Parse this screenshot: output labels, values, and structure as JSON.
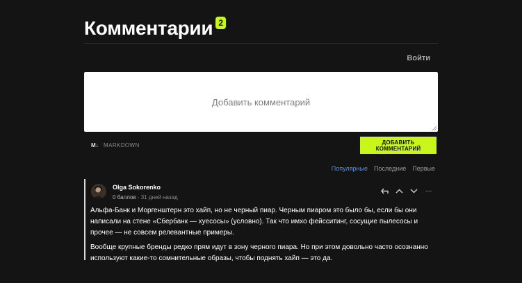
{
  "header": {
    "title": "Комментарии",
    "count": "2"
  },
  "auth": {
    "login_label": "Войти"
  },
  "editor": {
    "placeholder": "Добавить комментарий",
    "markdown_icon": "M↓",
    "markdown_label": "MARKDOWN",
    "submit_label": "ДОБАВИТЬ КОММЕНТАРИЙ"
  },
  "sort": {
    "options": [
      "Популярные",
      "Последние",
      "Первые"
    ],
    "active": "Популярные"
  },
  "comments": [
    {
      "author": "Olga Sokorenko",
      "score": "0 баллов",
      "time": "31 дней назад",
      "paragraphs": [
        "Альфа-Банк и Моргенштерн это хайп, но не черный пиар. Черным пиаром это было бы, если бы они написали на стене «Сбербанк — хуесосы» (условно). Так что имхо фейсситинг, сосущие пылесосы и прочее — не совсем релевантные примеры.",
        "Вообще крупные бренды редко прям идут в зону черного пиара. Но при этом довольно часто осознанно используют какие-то сомнительные образы, чтобы поднять хайп — это да."
      ]
    }
  ],
  "colors": {
    "background": "#141414",
    "accent": "#c8f51a",
    "link": "#4f8ef7"
  },
  "icons": {
    "reply": "reply-icon",
    "upvote": "chevron-up-icon",
    "downvote": "chevron-down-icon",
    "more": "dash-icon",
    "markdown": "markdown-icon"
  }
}
